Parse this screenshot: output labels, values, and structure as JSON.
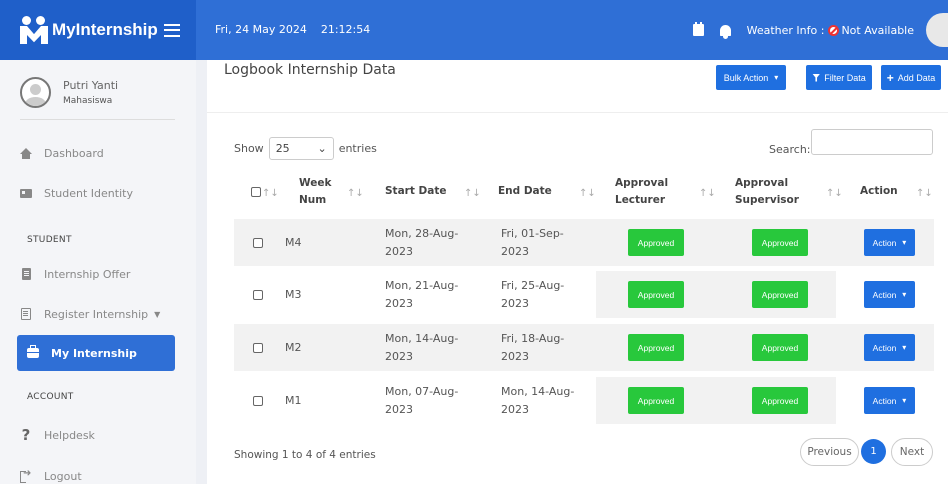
{
  "brand": {
    "name": "MyInternship"
  },
  "header": {
    "date": "Fri, 24 May 2024",
    "time": "21:12:54",
    "weather_label": "Weather Info :",
    "weather_value": "Not Available"
  },
  "profile": {
    "name": "Putri Yanti",
    "role": "Mahasiswa"
  },
  "sidebar": {
    "items": [
      {
        "label": "Dashboard",
        "icon": "home-icon"
      },
      {
        "label": "Student Identity",
        "icon": "id-card-icon"
      },
      {
        "label": "Internship Offer",
        "icon": "document-icon"
      },
      {
        "label": "Register Internship",
        "icon": "form-icon",
        "caret": "▼"
      },
      {
        "label": "My Internship",
        "icon": "briefcase-icon",
        "active": true
      },
      {
        "label": "Helpdesk",
        "icon": "question-icon"
      },
      {
        "label": "Logout",
        "icon": "logout-icon"
      }
    ],
    "sections": {
      "student": "STUDENT",
      "account": "ACCOUNT"
    }
  },
  "page": {
    "title": "Logbook Internship Data",
    "bulk_action": "Bulk Action",
    "filter_data": "Filter Data",
    "add_data": "Add Data"
  },
  "table_controls": {
    "show_label": "Show",
    "entries_value": "25",
    "entries_label": "entries",
    "search_label": "Search:",
    "search_value": ""
  },
  "table": {
    "headers": {
      "week_num": [
        "Week",
        "Num"
      ],
      "start_date": "Start Date",
      "end_date": "End Date",
      "approval_lecturer": [
        "Approval",
        "Lecturer"
      ],
      "approval_supervisor": [
        "Approval",
        "Supervisor"
      ],
      "action": "Action"
    },
    "sort_glyph": "↑↓",
    "rows": [
      {
        "week": "M4",
        "start": [
          "Mon, 28-Aug-",
          "2023"
        ],
        "end": [
          "Fri, 01-Sep-",
          "2023"
        ],
        "lecturer": "Approved",
        "supervisor": "Approved",
        "action": "Action"
      },
      {
        "week": "M3",
        "start": [
          "Mon, 21-Aug-",
          "2023"
        ],
        "end": [
          "Fri, 25-Aug-",
          "2023"
        ],
        "lecturer": "Approved",
        "supervisor": "Approved",
        "action": "Action"
      },
      {
        "week": "M2",
        "start": [
          "Mon, 14-Aug-",
          "2023"
        ],
        "end": [
          "Fri, 18-Aug-",
          "2023"
        ],
        "lecturer": "Approved",
        "supervisor": "Approved",
        "action": "Action"
      },
      {
        "week": "M1",
        "start": [
          "Mon, 07-Aug-",
          "2023"
        ],
        "end": [
          "Mon, 14-Aug-",
          "2023"
        ],
        "lecturer": "Approved",
        "supervisor": "Approved",
        "action": "Action"
      }
    ]
  },
  "footer": {
    "info": "Showing 1 to 4 of 4 entries",
    "previous": "Previous",
    "current_page": "1",
    "next": "Next"
  },
  "colors": {
    "primary": "#2f6fd6",
    "button": "#1f6fe0",
    "approved": "#28c83c",
    "not_available": "#e33333"
  }
}
